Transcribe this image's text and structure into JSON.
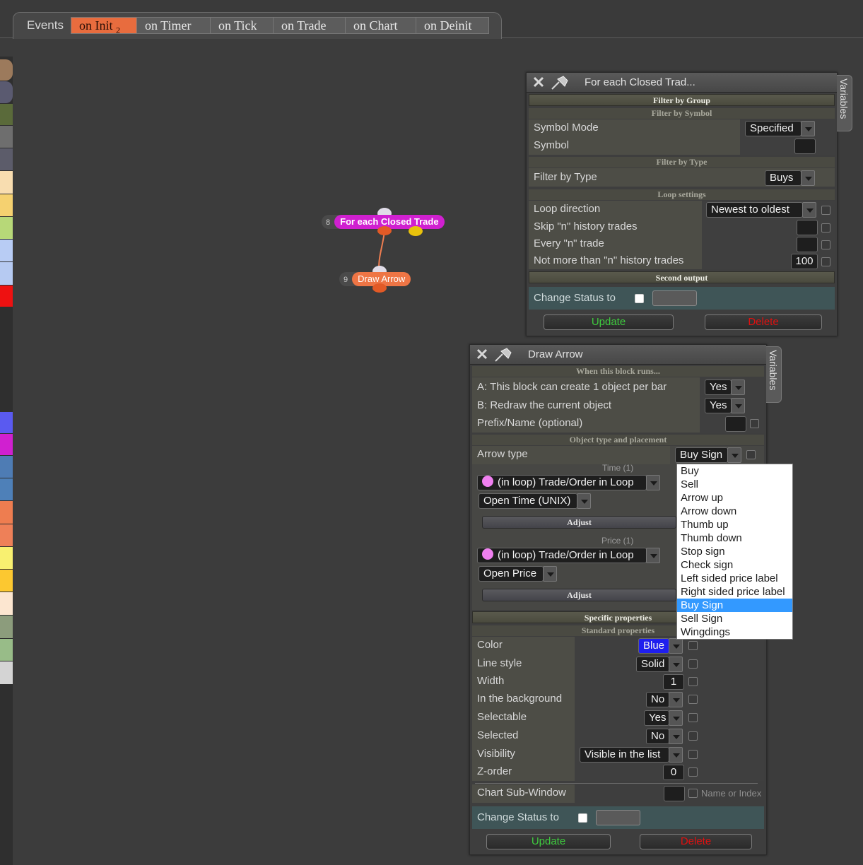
{
  "events_bar": {
    "label": "Events",
    "tabs": [
      {
        "name": "on Init",
        "badge": "2"
      },
      {
        "name": "on Timer"
      },
      {
        "name": "on Tick"
      },
      {
        "name": "on Trade"
      },
      {
        "name": "on Chart"
      },
      {
        "name": "on Deinit"
      }
    ],
    "active_tab": "on Init"
  },
  "palette_colors": [
    "#9c7a5c",
    "#5a5a70",
    "#5a6a3a",
    "#6e6e6e",
    "#5c5c6a",
    "#f8ddb0",
    "#f5d170",
    "#b7d878",
    "#b8ccf4",
    "#b6caf2",
    "#ee1111",
    "#5a5af0",
    "#d020d0",
    "#4e7cb4",
    "#4e80b8",
    "#ee7d50",
    "#ee8058",
    "#f8f070",
    "#fcc830",
    "#fce6d0",
    "#8c9c7c",
    "#98bc88",
    "#d4d4d4"
  ],
  "canvas": {
    "nodes": [
      {
        "id": "8",
        "label": "For each Closed Trade",
        "color": "#d020d0"
      },
      {
        "id": "9",
        "label": "Draw Arrow",
        "color": "#ee7545"
      }
    ]
  },
  "panel1": {
    "title": "For each Closed Trad...",
    "variables_tab": "Variables",
    "filter_by_group": "Filter by Group",
    "filter_by_symbol": "Filter by Symbol",
    "symbol_mode_label": "Symbol Mode",
    "symbol_mode_value": "Specified",
    "symbol_label": "Symbol",
    "filter_by_type_header": "Filter by Type",
    "filter_by_type_label": "Filter by Type",
    "filter_by_type_value": "Buys",
    "loop_settings": "Loop settings",
    "loop_direction_label": "Loop direction",
    "loop_direction_value": "Newest to oldest",
    "skip_label": "Skip \"n\" history trades",
    "every_label": "Every \"n\" trade",
    "not_more_label": "Not more than \"n\" history trades",
    "not_more_value": "100",
    "second_output": "Second output",
    "change_status_label": "Change Status to",
    "update_label": "Update",
    "delete_label": "Delete"
  },
  "panel2": {
    "title": "Draw Arrow",
    "variables_tab": "Variables",
    "when_runs": "When this block runs...",
    "a_label": "A: This block can create 1 object per bar",
    "a_value": "Yes",
    "b_label": "B: Redraw the current object",
    "b_value": "Yes",
    "prefix_label": "Prefix/Name (optional)",
    "obj_type_header": "Object type and placement",
    "arrow_type_label": "Arrow type",
    "arrow_type_value": "Buy Sign",
    "time_label": "Time (1)",
    "time_source": "(in loop) Trade/Order in Loop",
    "time_field": "Open Time (UNIX)",
    "adjust_label": "Adjust",
    "price_label": "Price (1)",
    "price_source": "(in loop) Trade/Order in Loop",
    "price_field": "Open Price",
    "specific_props": "Specific properties",
    "standard_props": "Standard properties",
    "color_label": "Color",
    "color_value": "Blue",
    "color_swatch": "#1f1fee",
    "line_style_label": "Line style",
    "line_style_value": "Solid",
    "width_label": "Width",
    "width_value": "1",
    "background_label": "In the background",
    "background_value": "No",
    "selectable_label": "Selectable",
    "selectable_value": "Yes",
    "selected_label": "Selected",
    "selected_value": "No",
    "visibility_label": "Visibility",
    "visibility_value": "Visible in the list",
    "zorder_label": "Z-order",
    "zorder_value": "0",
    "subwindow_label": "Chart Sub-Window",
    "name_or_index": "Name or Index",
    "change_status_label": "Change Status to",
    "update_label": "Update",
    "delete_label": "Delete"
  },
  "arrow_dropdown": {
    "options": [
      "Buy",
      "Sell",
      "Arrow up",
      "Arrow down",
      "Thumb up",
      "Thumb down",
      "Stop sign",
      "Check sign",
      "Left sided price label",
      "Right sided price label",
      "Buy Sign",
      "Sell Sign",
      "Wingdings"
    ],
    "highlighted": "Buy Sign"
  },
  "accent_colors": {
    "update": "#3ec93e",
    "delete": "#e01010",
    "active_tab": "#e86c3e",
    "highlight": "#3399ff"
  }
}
